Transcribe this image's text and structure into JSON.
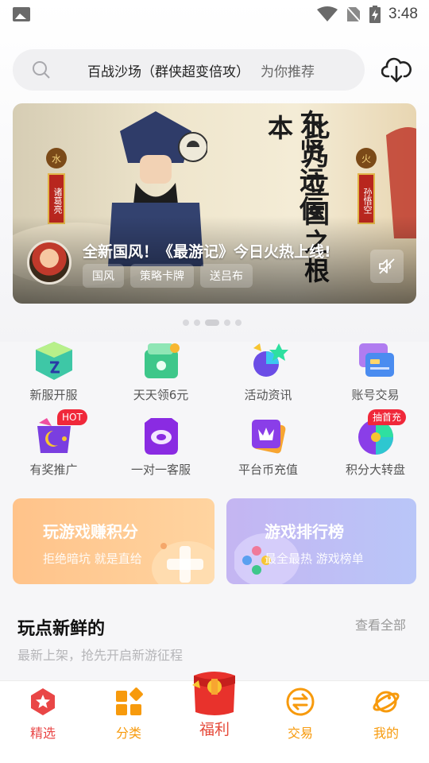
{
  "status_bar": {
    "time": "3:48"
  },
  "search": {
    "keyword": "百战沙场（群侠超变倍攻）",
    "recommend": "为你推荐"
  },
  "banner": {
    "headline": "全新国风！《最游记》今日火热上线!",
    "tags": [
      "国风",
      "策略卡牌",
      "送吕布"
    ],
    "calligraphy_line1": "东贤远佞",
    "calligraphy_line2": "此乃立国之根本",
    "char_left": "水",
    "char_right": "火",
    "name_tag_left": "诸葛亮",
    "name_tag_right": "孙悟空"
  },
  "carousel": {
    "count": 5,
    "active": 2
  },
  "grid": [
    {
      "label": "新服开服",
      "icon": "new-server-icon"
    },
    {
      "label": "天天领6元",
      "icon": "daily-reward-icon"
    },
    {
      "label": "活动资讯",
      "icon": "activity-news-icon"
    },
    {
      "label": "账号交易",
      "icon": "account-trade-icon"
    },
    {
      "label": "有奖推广",
      "icon": "promotion-icon",
      "badge": "HOT"
    },
    {
      "label": "一对一客服",
      "icon": "customer-service-icon"
    },
    {
      "label": "平台币充值",
      "icon": "coin-recharge-icon"
    },
    {
      "label": "积分大转盘",
      "icon": "points-wheel-icon",
      "badge": "抽首充"
    }
  ],
  "cards": {
    "earn": {
      "title": "玩游戏赚积分",
      "subtitle": "拒绝暗坑 就是直给"
    },
    "ranking": {
      "title": "游戏排行榜",
      "subtitle": "最全最热 游戏榜单"
    }
  },
  "section": {
    "title": "玩点新鲜的",
    "subtitle": "最新上架，抢先开启新游征程",
    "more": "查看全部"
  },
  "nav": [
    {
      "label": "精选",
      "icon": "featured-star-icon",
      "active": true
    },
    {
      "label": "分类",
      "icon": "category-icon"
    },
    {
      "label": "福利",
      "icon": "gift-icon"
    },
    {
      "label": "交易",
      "icon": "trade-icon"
    },
    {
      "label": "我的",
      "icon": "planet-icon"
    }
  ],
  "colors": {
    "accent_orange": "#f79a0c",
    "active_red": "#e94646",
    "badge_red": "#f0283a"
  }
}
